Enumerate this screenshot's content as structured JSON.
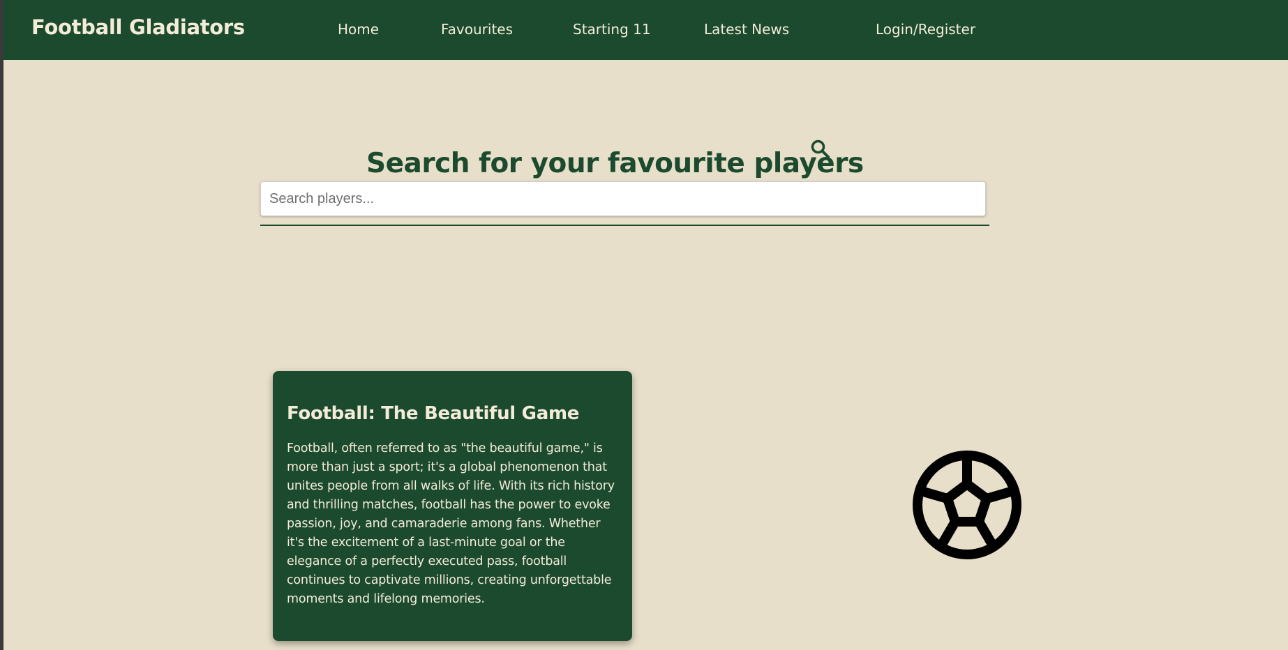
{
  "navbar": {
    "brand": "Football Gladiators",
    "links": [
      {
        "label": "Home"
      },
      {
        "label": "Favourites"
      },
      {
        "label": "Starting 11"
      },
      {
        "label": "Latest News"
      },
      {
        "label": "Login/Register"
      }
    ]
  },
  "search": {
    "heading": "Search for your favourite players",
    "placeholder": "Search players...",
    "value": "",
    "icon": "search-icon"
  },
  "card": {
    "title": "Football: The Beautiful Game",
    "body": "Football, often referred to as \"the beautiful game,\" is more than just a sport; it's a global phenomenon that unites people from all walks of life. With its rich history and thrilling matches, football has the power to evoke passion, joy, and camaraderie among fans. Whether it's the excitement of a last-minute goal or the elegance of a perfectly executed pass, football continues to captivate millions, creating unforgettable moments and lifelong memories."
  },
  "decor": {
    "icon": "soccer-ball-icon"
  },
  "colors": {
    "primary": "#1c4a2e",
    "background": "#e7dfc9",
    "light_text": "#f3ecd8"
  }
}
